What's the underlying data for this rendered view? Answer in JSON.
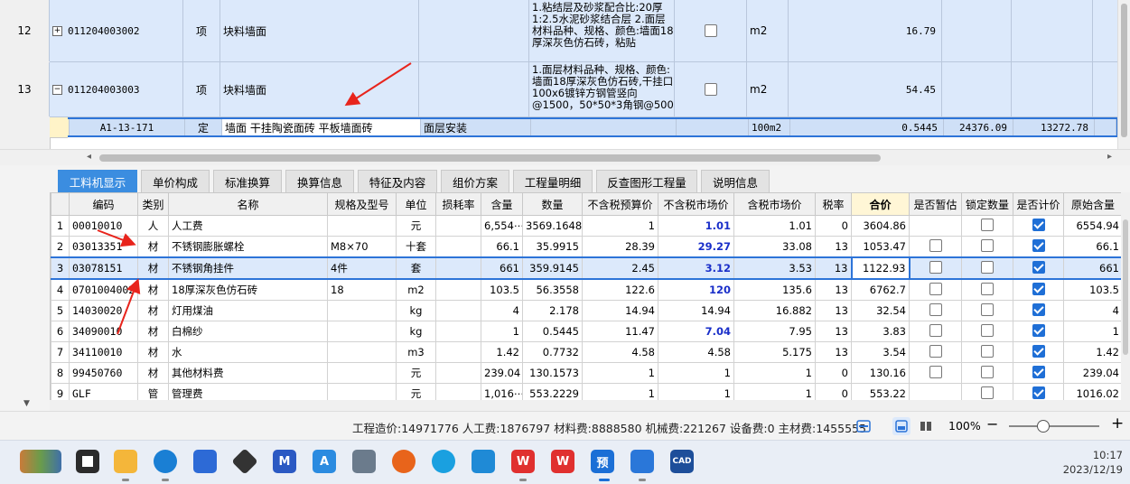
{
  "upper_grid": {
    "rows": [
      {
        "num": "12",
        "expander": "+",
        "code": "011204003002",
        "unit_kind": "项",
        "name": "块料墙面",
        "description": "1.粘结层及砂浆配合比:20厚1:2.5水泥砂浆结合层\n2.面层材料品种、规格、颜色:墙面18厚深灰色仿石砖，粘贴",
        "unit": "m2",
        "qty": "16.79"
      },
      {
        "num": "13",
        "expander": "−",
        "code": "011204003003",
        "unit_kind": "项",
        "name": "块料墙面",
        "description": "1.面层材料品种、规格、颜色:墙面18厚深灰色仿石砖,干挂口100x6镀锌方钢管竖向@1500，50*50*3角钢@500",
        "unit": "m2",
        "qty": "54.45"
      }
    ],
    "sub_row": {
      "code": "A1-13-171",
      "kind": "定",
      "name": "墙面 干挂陶瓷面砖 平板墙面砖",
      "description": "面层安装",
      "unit": "100m2",
      "qty": "0.5445",
      "price": "24376.09",
      "total": "13272.78"
    }
  },
  "tabs": [
    "工料机显示",
    "单价构成",
    "标准换算",
    "换算信息",
    "特征及内容",
    "组价方案",
    "工程量明细",
    "反查图形工程量",
    "说明信息"
  ],
  "active_tab": "工料机显示",
  "materials": {
    "columns": [
      "",
      "编码",
      "类别",
      "名称",
      "规格及型号",
      "单位",
      "损耗率",
      "含量",
      "数量",
      "不含税预算价",
      "不含税市场价",
      "含税市场价",
      "税率",
      "合价",
      "是否暂估",
      "锁定数量",
      "是否计价",
      "原始含量"
    ],
    "rows": [
      {
        "n": "1",
        "code": "00010010",
        "cat": "人",
        "name": "人工费",
        "spec": "",
        "unit": "元",
        "loss": "",
        "content": "6,554⋯",
        "qty": "3569.1648",
        "budget": "1",
        "market": "1.01",
        "taxmarket": "1.01",
        "rate": "0",
        "total": "3604.86",
        "temp": null,
        "lock": false,
        "priced": true,
        "orig": "6554.94"
      },
      {
        "n": "2",
        "code": "03013351",
        "cat": "材",
        "name": "不锈钢膨胀螺栓",
        "spec": "M8×70",
        "unit": "十套",
        "loss": "",
        "content": "66.1",
        "qty": "35.9915",
        "budget": "28.39",
        "market": "29.27",
        "taxmarket": "33.08",
        "rate": "13",
        "total": "1053.47",
        "temp": false,
        "lock": false,
        "priced": true,
        "orig": "66.1"
      },
      {
        "n": "3",
        "code": "03078151",
        "cat": "材",
        "name": "不锈钢角挂件",
        "spec": "4件",
        "unit": "套",
        "loss": "",
        "content": "661",
        "qty": "359.9145",
        "budget": "2.45",
        "market": "3.12",
        "taxmarket": "3.53",
        "rate": "13",
        "total": "1122.93",
        "temp": false,
        "lock": false,
        "priced": true,
        "orig": "661"
      },
      {
        "n": "4",
        "code": "0701004002",
        "cat": "材",
        "name": "18厚深灰色仿石砖",
        "spec": "18",
        "unit": "m2",
        "loss": "",
        "content": "103.5",
        "qty": "56.3558",
        "budget": "122.6",
        "market": "120",
        "taxmarket": "135.6",
        "rate": "13",
        "total": "6762.7",
        "temp": false,
        "lock": false,
        "priced": true,
        "orig": "103.5"
      },
      {
        "n": "5",
        "code": "14030020",
        "cat": "材",
        "name": "灯用煤油",
        "spec": "",
        "unit": "kg",
        "loss": "",
        "content": "4",
        "qty": "2.178",
        "budget": "14.94",
        "market": "14.94",
        "taxmarket": "16.882",
        "rate": "13",
        "total": "32.54",
        "temp": false,
        "lock": false,
        "priced": true,
        "orig": "4"
      },
      {
        "n": "6",
        "code": "34090010",
        "cat": "材",
        "name": "白棉纱",
        "spec": "",
        "unit": "kg",
        "loss": "",
        "content": "1",
        "qty": "0.5445",
        "budget": "11.47",
        "market": "7.04",
        "taxmarket": "7.95",
        "rate": "13",
        "total": "3.83",
        "temp": false,
        "lock": false,
        "priced": true,
        "orig": "1"
      },
      {
        "n": "7",
        "code": "34110010",
        "cat": "材",
        "name": "水",
        "spec": "",
        "unit": "m3",
        "loss": "",
        "content": "1.42",
        "qty": "0.7732",
        "budget": "4.58",
        "market": "4.58",
        "taxmarket": "5.175",
        "rate": "13",
        "total": "3.54",
        "temp": false,
        "lock": false,
        "priced": true,
        "orig": "1.42"
      },
      {
        "n": "8",
        "code": "99450760",
        "cat": "材",
        "name": "其他材料费",
        "spec": "",
        "unit": "元",
        "loss": "",
        "content": "239.04",
        "qty": "130.1573",
        "budget": "1",
        "market": "1",
        "taxmarket": "1",
        "rate": "0",
        "total": "130.16",
        "temp": false,
        "lock": false,
        "priced": true,
        "orig": "239.04"
      },
      {
        "n": "9",
        "code": "GLF",
        "cat": "管",
        "name": "管理费",
        "spec": "",
        "unit": "元",
        "loss": "",
        "content": "1,016⋯",
        "qty": "553.2229",
        "budget": "1",
        "market": "1",
        "taxmarket": "1",
        "rate": "0",
        "total": "553.22",
        "temp": null,
        "lock": false,
        "priced": true,
        "orig": "1016.02"
      }
    ],
    "highlighted_market_rows": [
      "1",
      "2",
      "3",
      "4",
      "6"
    ]
  },
  "status": {
    "summary": "工程造价:14971776  人工费:1876797  材料费:8888580  机械费:221267  设备费:0  主材费:1455555",
    "zoom": "100%"
  },
  "taskbar": {
    "time": "10:17",
    "date": "2023/12/19",
    "apps": [
      "start-icon",
      "file-explorer-icon",
      "edge-icon",
      "store-icon",
      "app-icon",
      "mail-icon",
      "browser-icon",
      "calculator-icon",
      "firefox-icon",
      "chat-icon",
      "notes-icon",
      "wps-icon",
      "wps-office-icon",
      "yu-icon",
      "glodon-icon",
      "cad-icon"
    ],
    "yu_label": "预",
    "cad_label": "CAD"
  }
}
